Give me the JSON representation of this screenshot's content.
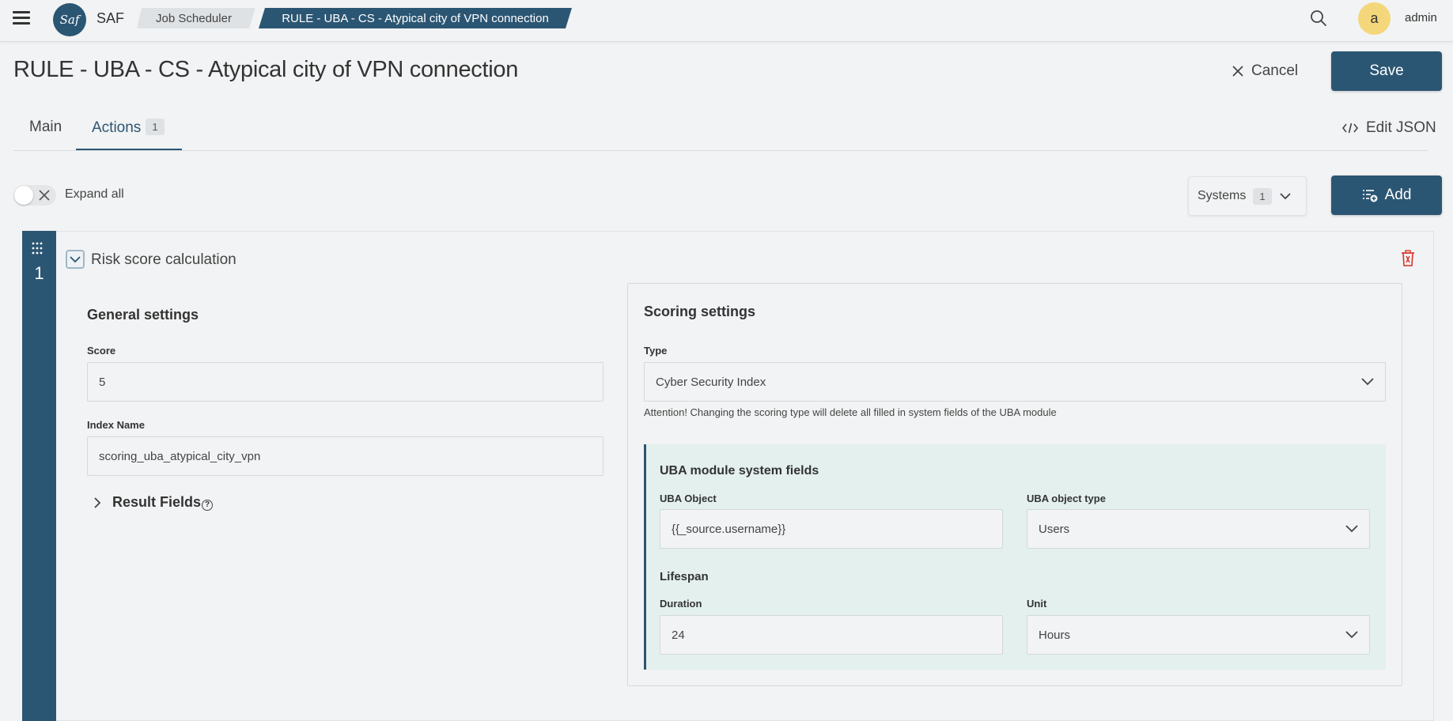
{
  "topbar": {
    "app_name": "SAF",
    "logo_text": "Saf",
    "breadcrumbs": [
      "Job Scheduler",
      "RULE - UBA - CS - Atypical city of VPN connection"
    ],
    "user_initial": "a",
    "username": "admin"
  },
  "header": {
    "title": "RULE - UBA - CS - Atypical city of VPN connection",
    "cancel_label": "Cancel",
    "save_label": "Save"
  },
  "tabs": [
    {
      "label": "Main",
      "active": false
    },
    {
      "label": "Actions",
      "badge": "1",
      "active": true
    }
  ],
  "edit_json_label": "Edit JSON",
  "toolbar": {
    "expand_all_label": "Expand all",
    "systems_label": "Systems",
    "systems_count": "1",
    "add_label": "Add"
  },
  "action": {
    "number": "1",
    "title": "Risk score calculation",
    "general": {
      "title": "General settings",
      "score_label": "Score",
      "score_value": "5",
      "index_name_label": "Index Name",
      "index_name_value": "scoring_uba_atypical_city_vpn",
      "result_fields_label": "Result Fields",
      "help_glyph": "?"
    },
    "scoring": {
      "title": "Scoring settings",
      "type_label": "Type",
      "type_value": "Cyber Security Index",
      "attention": "Attention! Changing the scoring type will delete all filled in system fields of the UBA module",
      "uba": {
        "title": "UBA module system fields",
        "object_label": "UBA Object",
        "object_value": "{{_source.username}}",
        "object_type_label": "UBA object type",
        "object_type_value": "Users",
        "lifespan_label": "Lifespan",
        "duration_label": "Duration",
        "duration_value": "24",
        "unit_label": "Unit",
        "unit_value": "Hours"
      }
    }
  },
  "colors": {
    "primary": "#2b5673",
    "background": "#f2f3f4",
    "uba_panel": "#e3f0ee",
    "avatar": "#f3d77a",
    "delete": "#d9322b"
  }
}
